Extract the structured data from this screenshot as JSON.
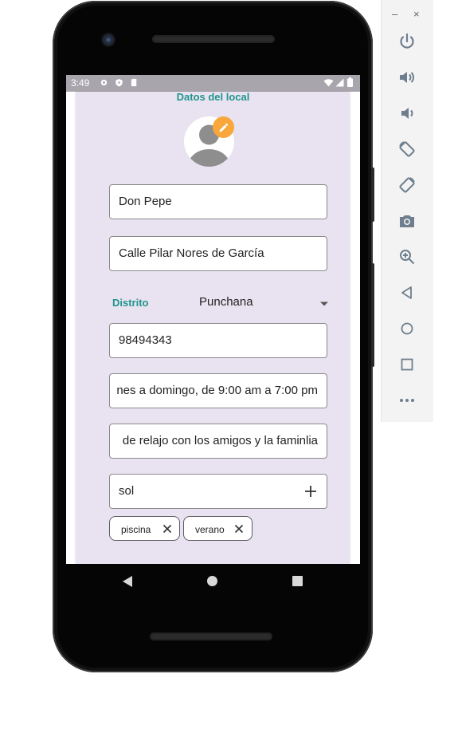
{
  "status_bar": {
    "time": "3:49"
  },
  "app": {
    "title": "Datos del local",
    "fields": {
      "name": "Don Pepe",
      "address": "Calle Pilar Nores de García",
      "phone": "98494343",
      "schedule": "nes a domingo, de 9:00 am a 7:00 pm",
      "description": "de relajo con los amigos y la faminlia",
      "tag_input": "sol"
    },
    "district": {
      "label": "Distrito",
      "value": "Punchana"
    },
    "chips": [
      {
        "label": "piscina"
      },
      {
        "label": "verano"
      }
    ]
  },
  "icons": {
    "edit": "pencil-icon",
    "dropdown": "arrow-drop-down-icon",
    "add": "plus-icon",
    "chip_remove": "close-icon"
  },
  "colors": {
    "accent": "#21948c",
    "card_background": "#e9e3f1",
    "edit_badge": "#f9a63a",
    "status_bar": "#a9a5ad"
  },
  "emulator_panel": {
    "minimize": "–",
    "close": "×"
  }
}
